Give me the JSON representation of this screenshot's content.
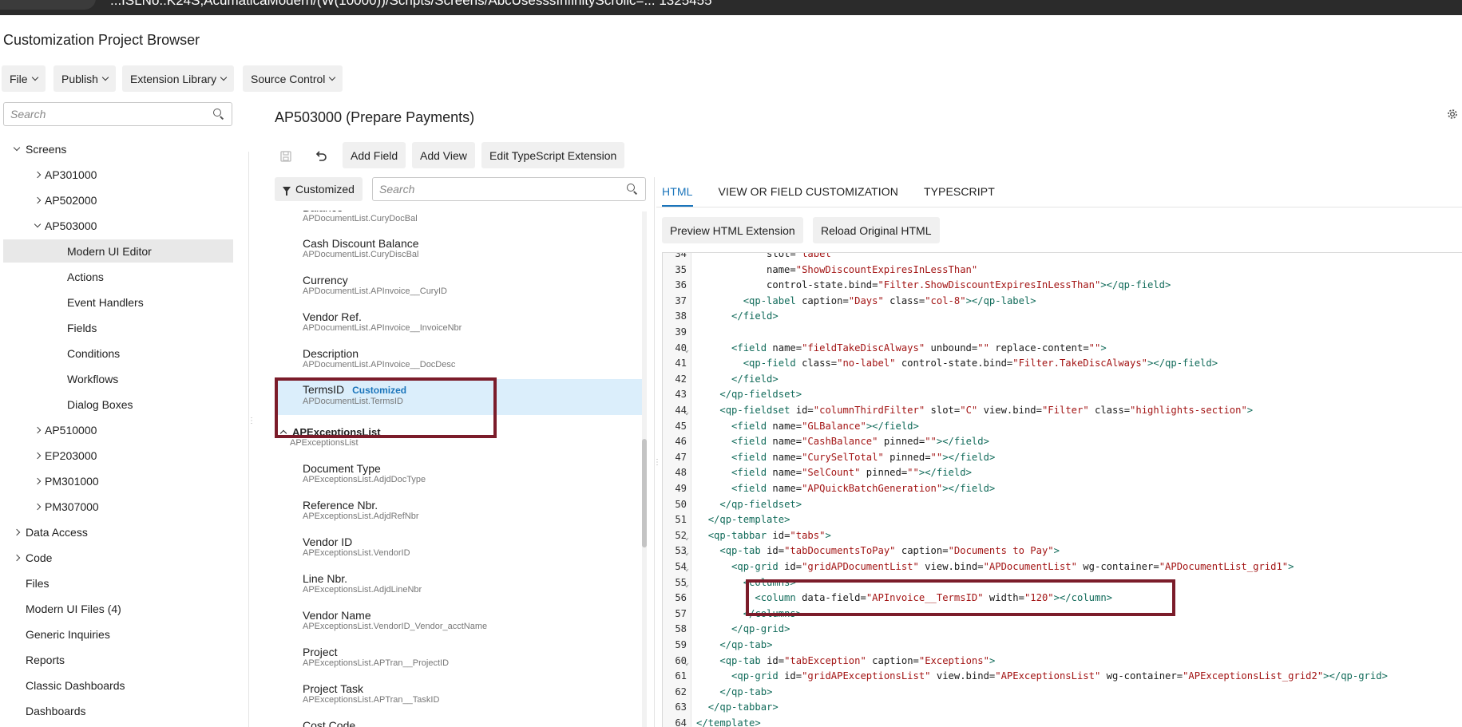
{
  "window": {
    "url_fragment": "...ISLNo.:K24S,AcumaticaModern/(W(10000))/Scripts/Screens/AbcUsesssInfinityScrollc=... 1325455"
  },
  "app": {
    "title": "Customization Project Browser"
  },
  "menu": [
    {
      "label": "File"
    },
    {
      "label": "Publish"
    },
    {
      "label": "Extension Library"
    },
    {
      "label": "Source Control"
    }
  ],
  "sidebar": {
    "search_placeholder": "Search",
    "items": [
      {
        "label": "Screens",
        "level": 0,
        "toggle": "expanded"
      },
      {
        "label": "AP301000",
        "level": 1,
        "toggle": "collapsed"
      },
      {
        "label": "AP502000",
        "level": 1,
        "toggle": "collapsed"
      },
      {
        "label": "AP503000",
        "level": 1,
        "toggle": "expanded"
      },
      {
        "label": "Modern UI Editor",
        "level": 2,
        "toggle": "none",
        "selected": true
      },
      {
        "label": "Actions",
        "level": 2,
        "toggle": "none"
      },
      {
        "label": "Event Handlers",
        "level": 2,
        "toggle": "none"
      },
      {
        "label": "Fields",
        "level": 2,
        "toggle": "none"
      },
      {
        "label": "Conditions",
        "level": 2,
        "toggle": "none"
      },
      {
        "label": "Workflows",
        "level": 2,
        "toggle": "none"
      },
      {
        "label": "Dialog Boxes",
        "level": 2,
        "toggle": "none"
      },
      {
        "label": "AP510000",
        "level": 1,
        "toggle": "collapsed"
      },
      {
        "label": "EP203000",
        "level": 1,
        "toggle": "collapsed"
      },
      {
        "label": "PM301000",
        "level": 1,
        "toggle": "collapsed"
      },
      {
        "label": "PM307000",
        "level": 1,
        "toggle": "collapsed"
      },
      {
        "label": "Data Access",
        "level": 0,
        "toggle": "collapsed"
      },
      {
        "label": "Code",
        "level": 0,
        "toggle": "collapsed"
      },
      {
        "label": "Files",
        "level": 0,
        "toggle": "none"
      },
      {
        "label": "Modern UI Files (4)",
        "level": 0,
        "toggle": "none"
      },
      {
        "label": "Generic Inquiries",
        "level": 0,
        "toggle": "none"
      },
      {
        "label": "Reports",
        "level": 0,
        "toggle": "none"
      },
      {
        "label": "Classic Dashboards",
        "level": 0,
        "toggle": "none"
      },
      {
        "label": "Dashboards",
        "level": 0,
        "toggle": "none"
      }
    ]
  },
  "screen": {
    "title": "AP503000 (Prepare Payments)",
    "toolbar": {
      "add_field": "Add Field",
      "add_view": "Add View",
      "edit_ts": "Edit TypeScript Extension"
    },
    "filter_label": "Customized",
    "field_search_placeholder": "Search",
    "fields": [
      {
        "name": "Balance",
        "path": "APDocumentList.CuryDocBal"
      },
      {
        "name": "Cash Discount Balance",
        "path": "APDocumentList.CuryDiscBal"
      },
      {
        "name": "Currency",
        "path": "APDocumentList.APInvoice__CuryID"
      },
      {
        "name": "Vendor Ref.",
        "path": "APDocumentList.APInvoice__InvoiceNbr"
      },
      {
        "name": "Description",
        "path": "APDocumentList.APInvoice__DocDesc"
      },
      {
        "name": "TermsID",
        "path": "APDocumentList.TermsID",
        "badge": "Customized",
        "selected": true
      }
    ],
    "group": {
      "name": "APExceptionsList",
      "path": "APExceptionsList"
    },
    "group_fields": [
      {
        "name": "Document Type",
        "path": "APExceptionsList.AdjdDocType"
      },
      {
        "name": "Reference Nbr.",
        "path": "APExceptionsList.AdjdRefNbr"
      },
      {
        "name": "Vendor ID",
        "path": "APExceptionsList.VendorID"
      },
      {
        "name": "Line Nbr.",
        "path": "APExceptionsList.AdjdLineNbr"
      },
      {
        "name": "Vendor Name",
        "path": "APExceptionsList.VendorID_Vendor_acctName"
      },
      {
        "name": "Project",
        "path": "APExceptionsList.APTran__ProjectID"
      },
      {
        "name": "Project Task",
        "path": "APExceptionsList.APTran__TaskID"
      },
      {
        "name": "Cost Code",
        "path": ""
      }
    ]
  },
  "editor": {
    "tabs": [
      {
        "label": "HTML",
        "active": true
      },
      {
        "label": "VIEW OR FIELD CUSTOMIZATION"
      },
      {
        "label": "TYPESCRIPT"
      }
    ],
    "preview_btn": "Preview HTML Extension",
    "reload_btn": "Reload Original HTML",
    "lines": [
      {
        "n": "34",
        "text": "            slot=\"label\""
      },
      {
        "n": "35",
        "text": "            name=\"ShowDiscountExpiresInLessThan\""
      },
      {
        "n": "36",
        "text": "            control-state.bind=\"Filter.ShowDiscountExpiresInLessThan\"></qp-field>"
      },
      {
        "n": "37",
        "text": "        <qp-label caption=\"Days\" class=\"col-8\"></qp-label>"
      },
      {
        "n": "38",
        "text": "      </field>"
      },
      {
        "n": "39",
        "text": ""
      },
      {
        "n": "40",
        "text": "      <field name=\"fieldTakeDiscAlways\" unbound=\"\" replace-content=\"\">",
        "fold": true
      },
      {
        "n": "41",
        "text": "        <qp-field class=\"no-label\" control-state.bind=\"Filter.TakeDiscAlways\"></qp-field>"
      },
      {
        "n": "42",
        "text": "      </field>"
      },
      {
        "n": "43",
        "text": "    </qp-fieldset>"
      },
      {
        "n": "44",
        "text": "    <qp-fieldset id=\"columnThirdFilter\" slot=\"C\" view.bind=\"Filter\" class=\"highlights-section\">",
        "fold": true
      },
      {
        "n": "45",
        "text": "      <field name=\"GLBalance\"></field>"
      },
      {
        "n": "46",
        "text": "      <field name=\"CashBalance\" pinned=\"\"></field>"
      },
      {
        "n": "47",
        "text": "      <field name=\"CurySelTotal\" pinned=\"\"></field>"
      },
      {
        "n": "48",
        "text": "      <field name=\"SelCount\" pinned=\"\"></field>"
      },
      {
        "n": "49",
        "text": "      <field name=\"APQuickBatchGeneration\"></field>"
      },
      {
        "n": "50",
        "text": "    </qp-fieldset>"
      },
      {
        "n": "51",
        "text": "  </qp-template>"
      },
      {
        "n": "52",
        "text": "  <qp-tabbar id=\"tabs\">",
        "fold": true
      },
      {
        "n": "53",
        "text": "    <qp-tab id=\"tabDocumentsToPay\" caption=\"Documents to Pay\">",
        "fold": true
      },
      {
        "n": "54",
        "text": "      <qp-grid id=\"gridAPDocumentList\" view.bind=\"APDocumentList\" wg-container=\"APDocumentList_grid1\">",
        "fold": true
      },
      {
        "n": "55",
        "text": "        <columns>",
        "fold": true
      },
      {
        "n": "56",
        "text": "          <column data-field=\"APInvoice__TermsID\" width=\"120\"></column>"
      },
      {
        "n": "57",
        "text": "        </columns>"
      },
      {
        "n": "58",
        "text": "      </qp-grid>"
      },
      {
        "n": "59",
        "text": "    </qp-tab>"
      },
      {
        "n": "60",
        "text": "    <qp-tab id=\"tabException\" caption=\"Exceptions\">",
        "fold": true
      },
      {
        "n": "61",
        "text": "      <qp-grid id=\"gridAPExceptionsList\" view.bind=\"APExceptionsList\" wg-container=\"APExceptionsList_grid2\"></qp-grid>"
      },
      {
        "n": "62",
        "text": "    </qp-tab>"
      },
      {
        "n": "63",
        "text": "  </qp-tabbar>"
      },
      {
        "n": "64",
        "text": "</template>"
      }
    ]
  },
  "colors": {
    "accent": "#1b75bb",
    "highlight_box": "#7b1c2a",
    "selected_row": "#dbeefb",
    "tag": "#116b5a",
    "string": "#a31515"
  }
}
